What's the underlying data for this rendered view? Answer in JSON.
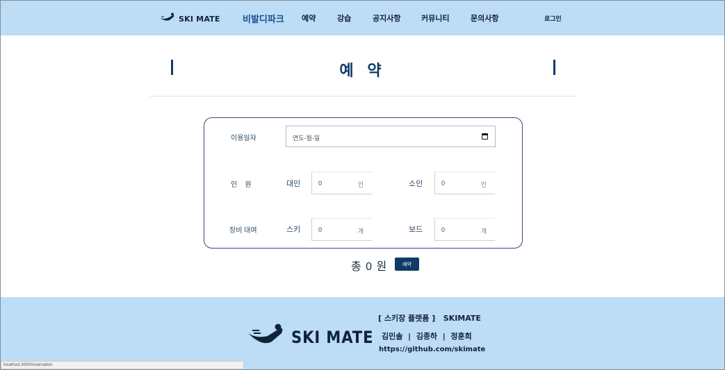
{
  "header": {
    "brand": "SKI MATE",
    "nav": [
      "비발디파크",
      "예약",
      "강습",
      "공지사항",
      "커뮤니티",
      "문의사항"
    ],
    "login": "로그인"
  },
  "page": {
    "title": "예 약"
  },
  "form": {
    "date_label": "이용일자",
    "date_placeholder": "연도-월-일",
    "people_label": "인    원",
    "adult_label": "대인",
    "adult_value": "0",
    "adult_unit": "인",
    "child_label": "소인",
    "child_value": "0",
    "child_unit": "인",
    "rental_label": "장비 대여",
    "ski_label": "스키",
    "ski_value": "0",
    "ski_unit": "개",
    "board_label": "보드",
    "board_value": "0",
    "board_unit": "개"
  },
  "total": {
    "text": "총 0 원",
    "button": "예약"
  },
  "footer": {
    "brand": "SKI MATE",
    "platform": "[ 스키장 플랫폼 ]   SKIMATE",
    "members": "김민솔  |  김종하  |  정훈희",
    "github": "https://github.com/skimate"
  },
  "status_bar": "localhost:3000/reservation",
  "colors": {
    "accent": "#0f3b66",
    "header_bg": "#bddcf5"
  }
}
